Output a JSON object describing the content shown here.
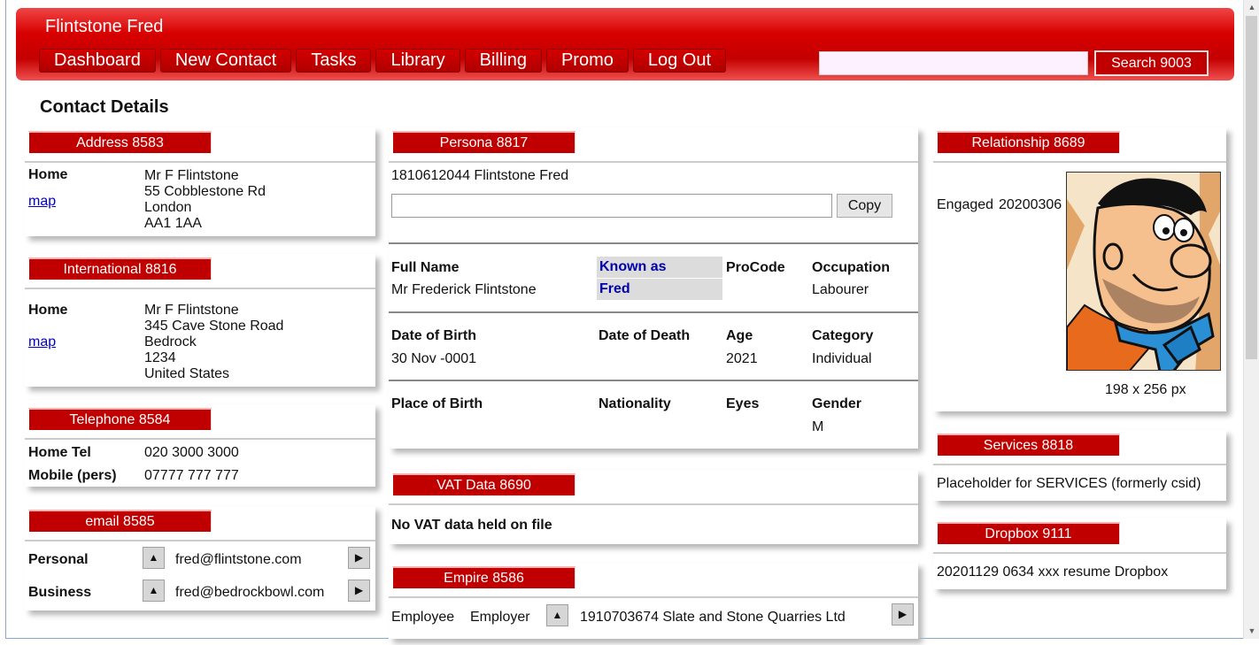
{
  "header": {
    "title": "Flintstone Fred",
    "nav": [
      "Dashboard",
      "New Contact",
      "Tasks",
      "Library",
      "Billing",
      "Promo",
      "Log Out"
    ],
    "search_placeholder": "",
    "search_label": "Search 9003"
  },
  "page_title": "Contact Details",
  "address": {
    "title": "Address 8583",
    "label": "Home",
    "map": "map",
    "lines": [
      "Mr F Flintstone",
      "55 Cobblestone Rd",
      "London",
      "AA1 1AA"
    ]
  },
  "international": {
    "title": "International 8816",
    "label": "Home",
    "map": "map",
    "lines": [
      "Mr F Flintstone",
      "345 Cave Stone Road",
      "Bedrock",
      "1234",
      "United States"
    ]
  },
  "telephone": {
    "title": "Telephone 8584",
    "rows": [
      {
        "label": "Home Tel",
        "value": "020 3000 3000"
      },
      {
        "label": "Mobile (pers)",
        "value": "07777 777 777"
      }
    ]
  },
  "email": {
    "title": "email 8585",
    "rows": [
      {
        "label": "Personal",
        "value": "fred@flintstone.com"
      },
      {
        "label": "Business",
        "value": "fred@bedrockbowl.com"
      }
    ]
  },
  "persona": {
    "title": "Persona 8817",
    "id_line": "1810612044 Flintstone Fred",
    "copy_label": "Copy",
    "full_name_label": "Full Name",
    "full_name": "Mr Frederick Flintstone",
    "known_as_label": "Known as",
    "known_as": "Fred",
    "procode_label": "ProCode",
    "occupation_label": "Occupation",
    "occupation": "Labourer",
    "dob_label": "Date of Birth",
    "dob": "30 Nov -0001",
    "dod_label": "Date of Death",
    "age_label": "Age",
    "age": "2021",
    "category_label": "Category",
    "category": "Individual",
    "pob_label": "Place of Birth",
    "nationality_label": "Nationality",
    "eyes_label": "Eyes",
    "gender_label": "Gender",
    "gender": "M"
  },
  "vat": {
    "title": "VAT Data 8690",
    "message": "No VAT data held on file"
  },
  "empire": {
    "title": "Empire 8586",
    "role": "Employee",
    "relation": "Employer",
    "entity": "1910703674 Slate and Stone Quarries Ltd"
  },
  "relationship": {
    "title": "Relationship 8689",
    "status": "Engaged",
    "date": "20200306",
    "image_size": "198 x 256 px"
  },
  "services": {
    "title": "Services 8818",
    "text": "Placeholder for SERVICES (formerly csid)"
  },
  "dropbox": {
    "title": "Dropbox 9111",
    "text": "20201129 0634 xxx resume Dropbox"
  },
  "colors": {
    "header_red": "#c40000",
    "link_blue": "#0000cc",
    "known_as_bg": "#dcdcdc"
  },
  "icons": {
    "up": "triangle-up-icon",
    "go": "triangle-right-icon"
  }
}
